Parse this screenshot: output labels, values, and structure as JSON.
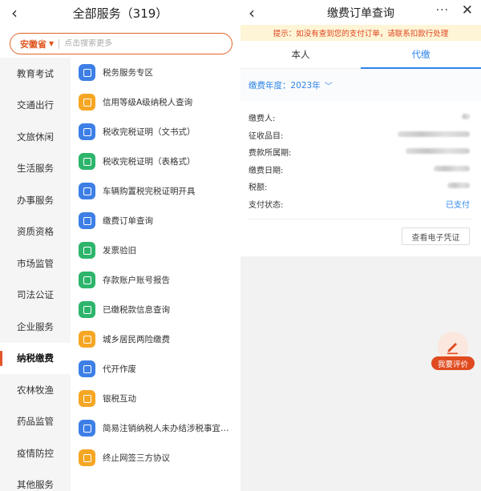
{
  "left": {
    "title": "全部服务（319）",
    "search": {
      "province": "安徽省",
      "placeholder": "点击搜索更多"
    },
    "categories": [
      {
        "label": "教育考试"
      },
      {
        "label": "交通出行"
      },
      {
        "label": "文旅休闲"
      },
      {
        "label": "生活服务"
      },
      {
        "label": "办事服务"
      },
      {
        "label": "资质资格"
      },
      {
        "label": "市场监管"
      },
      {
        "label": "司法公证"
      },
      {
        "label": "企业服务"
      },
      {
        "label": "纳税缴费",
        "active": true
      },
      {
        "label": "农林牧渔"
      },
      {
        "label": "药品监管"
      },
      {
        "label": "疫情防控"
      },
      {
        "label": "其他服务"
      }
    ],
    "services": [
      {
        "label": "税务服务专区",
        "color": "#3d7fe6",
        "icon": "tax-hall-icon"
      },
      {
        "label": "信用等级A级纳税人查询",
        "color": "#f5a623",
        "icon": "credit-a-icon"
      },
      {
        "label": "税收完税证明（文书式）",
        "color": "#3d7fe6",
        "icon": "document-icon"
      },
      {
        "label": "税收完税证明（表格式）",
        "color": "#2db56b",
        "icon": "table-icon"
      },
      {
        "label": "车辆购置税完税证明开具",
        "color": "#3d7fe6",
        "icon": "car-icon"
      },
      {
        "label": "缴费订单查询",
        "color": "#3d7fe6",
        "icon": "order-search-icon"
      },
      {
        "label": "发票验旧",
        "color": "#2db56b",
        "icon": "invoice-icon"
      },
      {
        "label": "存款账户账号报告",
        "color": "#2db56b",
        "icon": "yen-icon"
      },
      {
        "label": "已缴税款信息查询",
        "color": "#2db56b",
        "icon": "paid-tax-icon"
      },
      {
        "label": "城乡居民两险缴费",
        "color": "#f5a623",
        "icon": "insurance-icon"
      },
      {
        "label": "代开作废",
        "color": "#3d7fe6",
        "icon": "void-icon"
      },
      {
        "label": "银税互动",
        "color": "#f5a623",
        "icon": "bank-tax-icon"
      },
      {
        "label": "简易注销纳税人未办结涉税事宜…",
        "color": "#3d7fe6",
        "icon": "cancel-search-icon"
      },
      {
        "label": "终止网签三方协议",
        "color": "#f5a623",
        "icon": "agreement-icon"
      }
    ]
  },
  "right": {
    "title": "缴费订单查询",
    "more": "···",
    "close": "✕",
    "notice": "提示：如没有查到您的支付订单，请联系扣款行处理",
    "tabs": [
      {
        "label": "本人",
        "active": false
      },
      {
        "label": "代缴",
        "active": true
      }
    ],
    "year_label": "缴费年度：2023年",
    "fields": [
      {
        "label": "缴费人:",
        "status": ""
      },
      {
        "label": "征收品目:",
        "status": ""
      },
      {
        "label": "费款所属期:",
        "status": ""
      },
      {
        "label": "缴费日期:",
        "status": ""
      },
      {
        "label": "税额:",
        "status": ""
      },
      {
        "label": "支付状态:",
        "status": "已支付"
      }
    ],
    "voucher_button": "查看电子凭证",
    "rate_button": "我要评价"
  },
  "colors": {
    "accent": "#2d85e8",
    "brand_orange": "#e0551f",
    "notice_bg": "#fdf5d6"
  }
}
